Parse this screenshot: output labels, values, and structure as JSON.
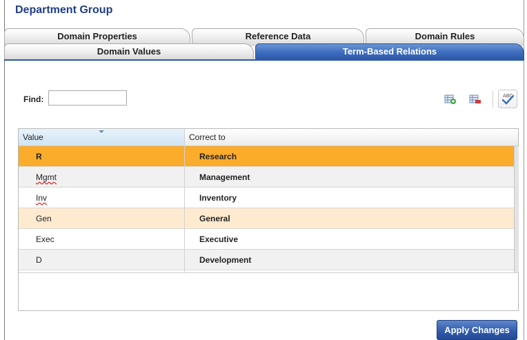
{
  "window": {
    "title": "Department Group"
  },
  "tabs": {
    "back_row": [
      {
        "label": "Domain Properties"
      },
      {
        "label": "Reference Data"
      },
      {
        "label": "Domain Rules"
      }
    ],
    "front_row": [
      {
        "label": "Domain Values"
      },
      {
        "label": "Term-Based Relations",
        "active": true
      }
    ]
  },
  "find": {
    "label": "Find:",
    "value": "",
    "placeholder": ""
  },
  "toolbar": {
    "icons": [
      "add-relation-icon",
      "delete-relation-icon",
      "spell-check-icon"
    ],
    "spell_text": "ABC"
  },
  "grid": {
    "columns": [
      "Value",
      "Correct to"
    ],
    "sorted_column": "Value",
    "rows": [
      {
        "value": "R",
        "correct_to": "Research",
        "state": "selected"
      },
      {
        "value": "Mgmt",
        "correct_to": "Management",
        "state": "normal",
        "spelling_flag": true
      },
      {
        "value": "Inv",
        "correct_to": "Inventory",
        "state": "normal",
        "spelling_flag": true
      },
      {
        "value": "Gen",
        "correct_to": "General",
        "state": "highlighted"
      },
      {
        "value": "Exec",
        "correct_to": "Executive",
        "state": "normal"
      },
      {
        "value": "D",
        "correct_to": "Development",
        "state": "normal"
      }
    ]
  },
  "actions": {
    "apply_label": "Apply Changes"
  },
  "colors": {
    "accent_blue": "#2d58a6",
    "title_blue": "#1f3d87",
    "selected_row": "#fbac2a",
    "highlight_row": "#fdeacf"
  }
}
